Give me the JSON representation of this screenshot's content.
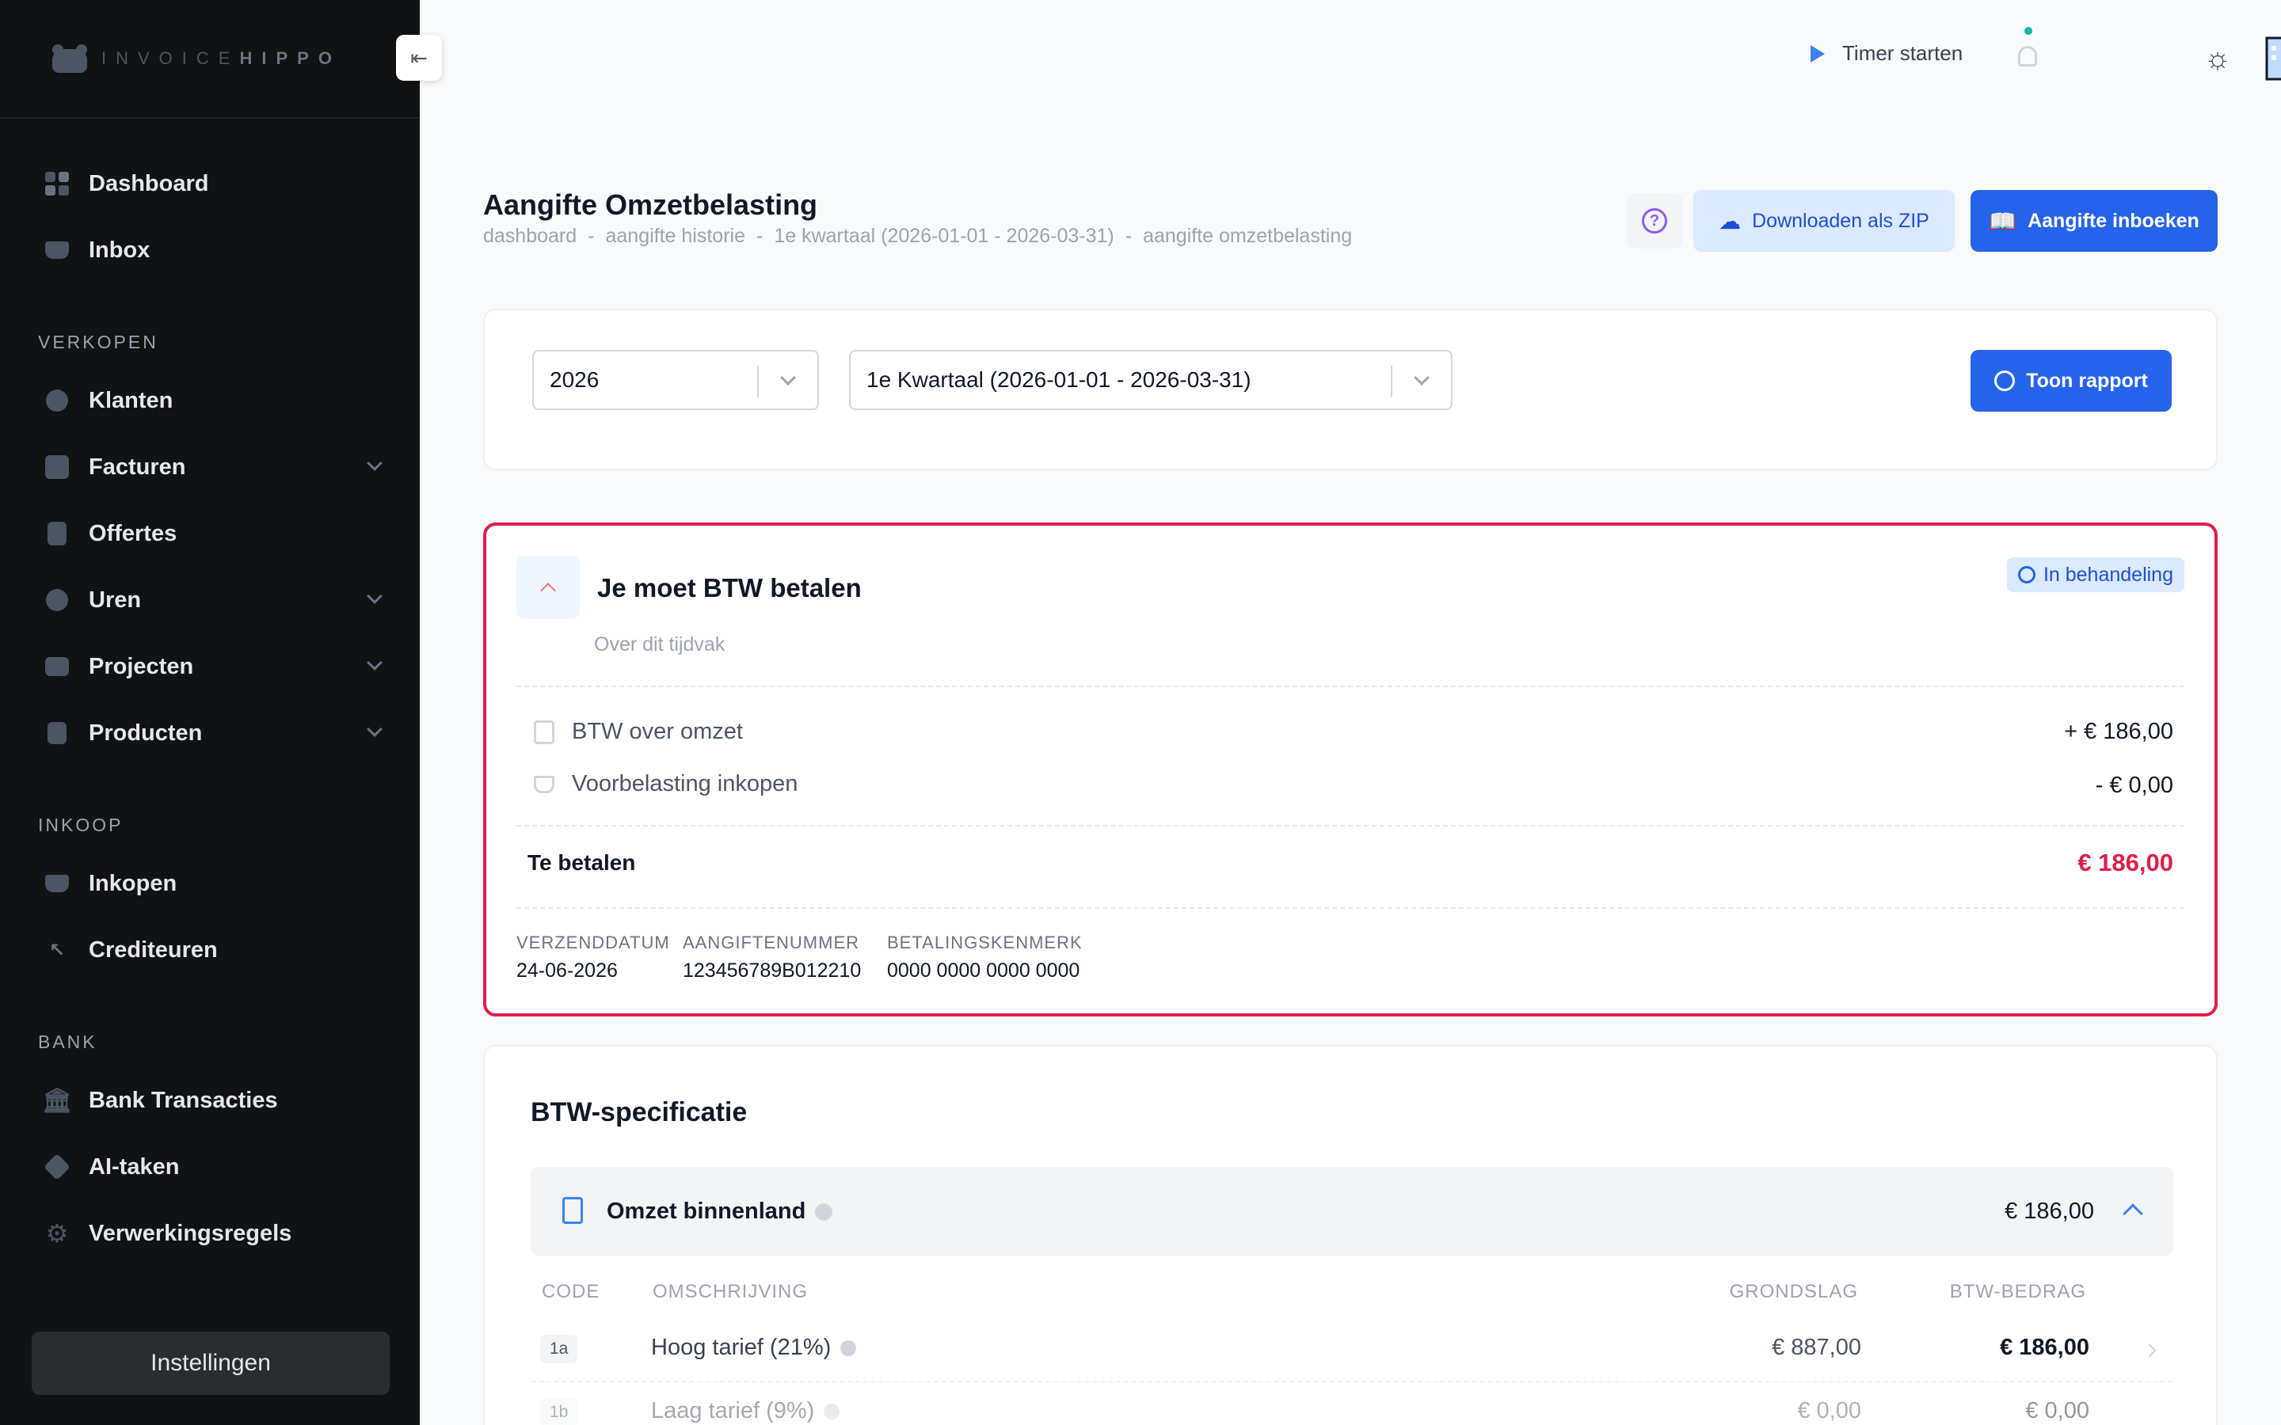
{
  "brand": {
    "logo_light": "INVOICE",
    "logo_bold": "HIPPO"
  },
  "sidebar": {
    "items_top": [
      {
        "label": "Dashboard",
        "icon": "dashboard-grid-icon"
      },
      {
        "label": "Inbox",
        "icon": "inbox-icon"
      }
    ],
    "section_verkopen": "VERKOPEN",
    "verkopen": [
      {
        "label": "Klanten",
        "icon": "users-icon"
      },
      {
        "label": "Facturen",
        "icon": "invoice-icon",
        "expandable": true
      },
      {
        "label": "Offertes",
        "icon": "quote-icon"
      },
      {
        "label": "Uren",
        "icon": "clock-icon",
        "expandable": true
      },
      {
        "label": "Projecten",
        "icon": "briefcase-icon",
        "expandable": true
      },
      {
        "label": "Producten",
        "icon": "box-icon",
        "expandable": true
      }
    ],
    "section_inkoop": "INKOOP",
    "inkoop": [
      {
        "label": "Inkopen",
        "icon": "cart-icon"
      },
      {
        "label": "Crediteuren",
        "icon": "arrow-up-left-icon"
      }
    ],
    "section_bank": "BANK",
    "bank": [
      {
        "label": "Bank Transacties",
        "icon": "bank-icon"
      },
      {
        "label": "AI-taken",
        "icon": "layers-icon"
      },
      {
        "label": "Verwerkingsregels",
        "icon": "cog-icon"
      }
    ],
    "settings_label": "Instellingen"
  },
  "topbar": {
    "timer_label": "Timer starten"
  },
  "page": {
    "title": "Aangifte Omzetbelasting",
    "breadcrumb": [
      "dashboard",
      "aangifte historie",
      "1e kwartaal (2026-01-01 - 2026-03-31)",
      "aangifte omzetbelasting"
    ],
    "download_zip_label": "Downloaden als ZIP",
    "book_label": "Aangifte inboeken"
  },
  "filters": {
    "year": "2026",
    "period": "1e Kwartaal (2026-01-01 - 2026-03-31)",
    "report_button": "Toon rapport"
  },
  "btw_summary": {
    "title": "Je moet BTW betalen",
    "subtitle": "Over dit tijdvak",
    "status": "In behandeling",
    "status_color": "#2563eb",
    "rows": [
      {
        "label": "BTW over omzet",
        "value": "+ € 186,00"
      },
      {
        "label": "Voorbelasting inkopen",
        "value": "- € 0,00"
      }
    ],
    "total_label": "Te betalen",
    "total_value": "€ 186,00",
    "total_color": "#e11d48",
    "meta": [
      {
        "label": "VERZENDDATUM",
        "value": "24-06-2026"
      },
      {
        "label": "AANGIFTENUMMER",
        "value": "123456789B012210"
      },
      {
        "label": "BETALINGSKENMERK",
        "value": "0000 0000 0000 0000"
      }
    ]
  },
  "spec": {
    "title": "BTW-specificatie",
    "group_name": "Omzet binnenland",
    "group_total": "€ 186,00",
    "columns": {
      "code": "CODE",
      "desc": "OMSCHRIJVING",
      "base": "GRONDSLAG",
      "amount": "BTW-BEDRAG"
    },
    "rows": [
      {
        "code": "1a",
        "desc": "Hoog tarief (21%)",
        "base": "€ 887,00",
        "amount": "€ 186,00"
      },
      {
        "code": "1b",
        "desc": "Laag tarief (9%)",
        "base": "€ 0,00",
        "amount": "€ 0,00"
      }
    ]
  }
}
